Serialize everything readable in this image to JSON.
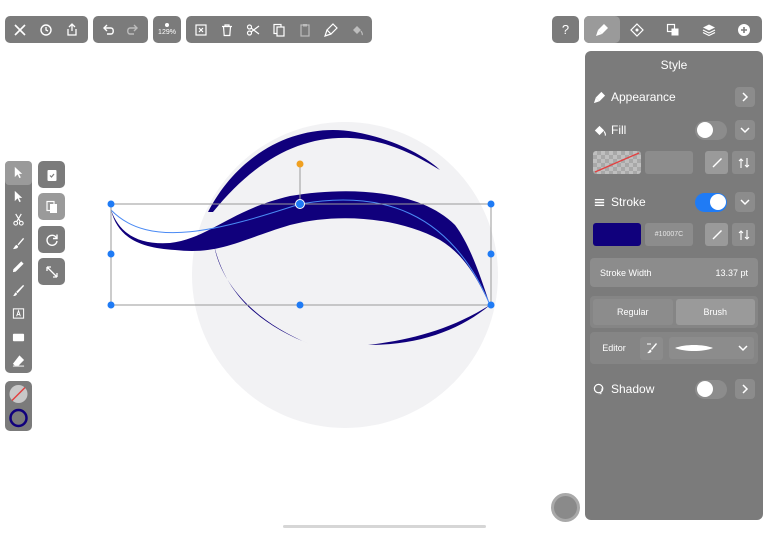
{
  "top_toolbar": {
    "zoom_label": "129%"
  },
  "help": {
    "label": "?"
  },
  "panel": {
    "title": "Style",
    "appearance": {
      "label": "Appearance"
    },
    "fill": {
      "label": "Fill",
      "enabled": false
    },
    "stroke": {
      "label": "Stroke",
      "enabled": true,
      "color": "#10007C",
      "hex_label": "#10007C"
    },
    "stroke_width": {
      "label": "Stroke Width",
      "value": "13.37 pt"
    },
    "stroke_mode": {
      "regular": "Regular",
      "brush": "Brush",
      "selected": "Brush"
    },
    "editor": {
      "label": "Editor"
    },
    "shadow": {
      "label": "Shadow",
      "enabled": false
    }
  },
  "colors": {
    "toolbar_bg": "#7b7b7b",
    "accent": "#1f7bf5",
    "stroke_color": "#10007C",
    "selection": "#1f7bf5",
    "rotate_handle": "#f0a020"
  },
  "icons": {
    "top_toolbar": [
      "close-icon",
      "history-icon",
      "share-icon",
      "undo-icon",
      "redo-icon",
      "deselect-icon",
      "trash-icon",
      "scissors-icon",
      "copy-icon",
      "paste-icon",
      "paste-style-icon",
      "fill-style-icon"
    ],
    "right_tabs": [
      "style-brush-icon",
      "arrange-icon",
      "path-ops-icon",
      "layers-icon",
      "add-icon"
    ],
    "left_tools": [
      "selection-arrow-icon",
      "direct-select-icon",
      "scissors-tool-icon",
      "brush-icon",
      "pen-icon",
      "pencil-icon",
      "text-tool-icon",
      "rectangle-tool-icon",
      "eraser-icon"
    ]
  }
}
